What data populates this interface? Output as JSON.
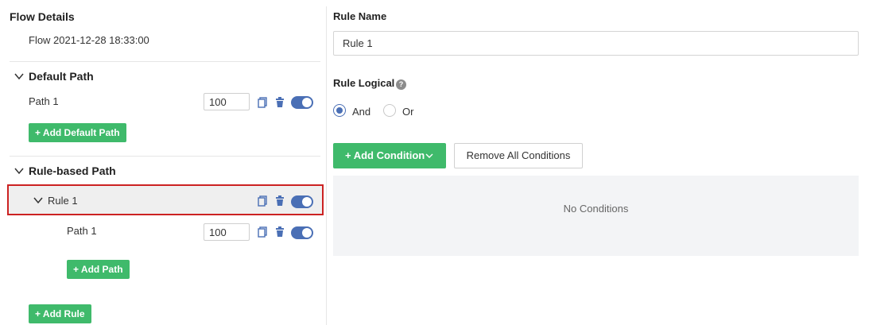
{
  "flow": {
    "title": "Flow Details",
    "name": "Flow 2021-12-28 18:33:00"
  },
  "default_path": {
    "heading": "Default Path",
    "paths": [
      {
        "label": "Path 1",
        "value": "100",
        "enabled": true
      }
    ],
    "add_label": "+ Add Default Path"
  },
  "rule_path": {
    "heading": "Rule-based Path",
    "rules": [
      {
        "label": "Rule 1",
        "enabled": true,
        "paths": [
          {
            "label": "Path 1",
            "value": "100",
            "enabled": true
          }
        ],
        "add_path_label": "+ Add Path"
      }
    ],
    "add_rule_label": "+ Add Rule"
  },
  "icons": {
    "chevron": "chevron-down-icon",
    "copy": "copy-icon",
    "delete": "trash-icon",
    "toggle": "toggle-switch",
    "help": "question-circle-icon"
  },
  "rule_editor": {
    "name_label": "Rule Name",
    "name_value": "Rule 1",
    "logical_label": "Rule Logical",
    "logical_help": "?",
    "logical_options": [
      {
        "label": "And",
        "checked": true
      },
      {
        "label": "Or",
        "checked": false
      }
    ],
    "add_condition_label": "+ Add Condition",
    "remove_all_label": "Remove All Conditions",
    "empty_text": "No Conditions"
  },
  "colors": {
    "accent_green": "#3fba6b",
    "toggle_blue": "#4a6fb5",
    "highlight_border": "#cc2222",
    "highlight_bg": "#efefef",
    "conditions_bg": "#f3f4f6"
  }
}
